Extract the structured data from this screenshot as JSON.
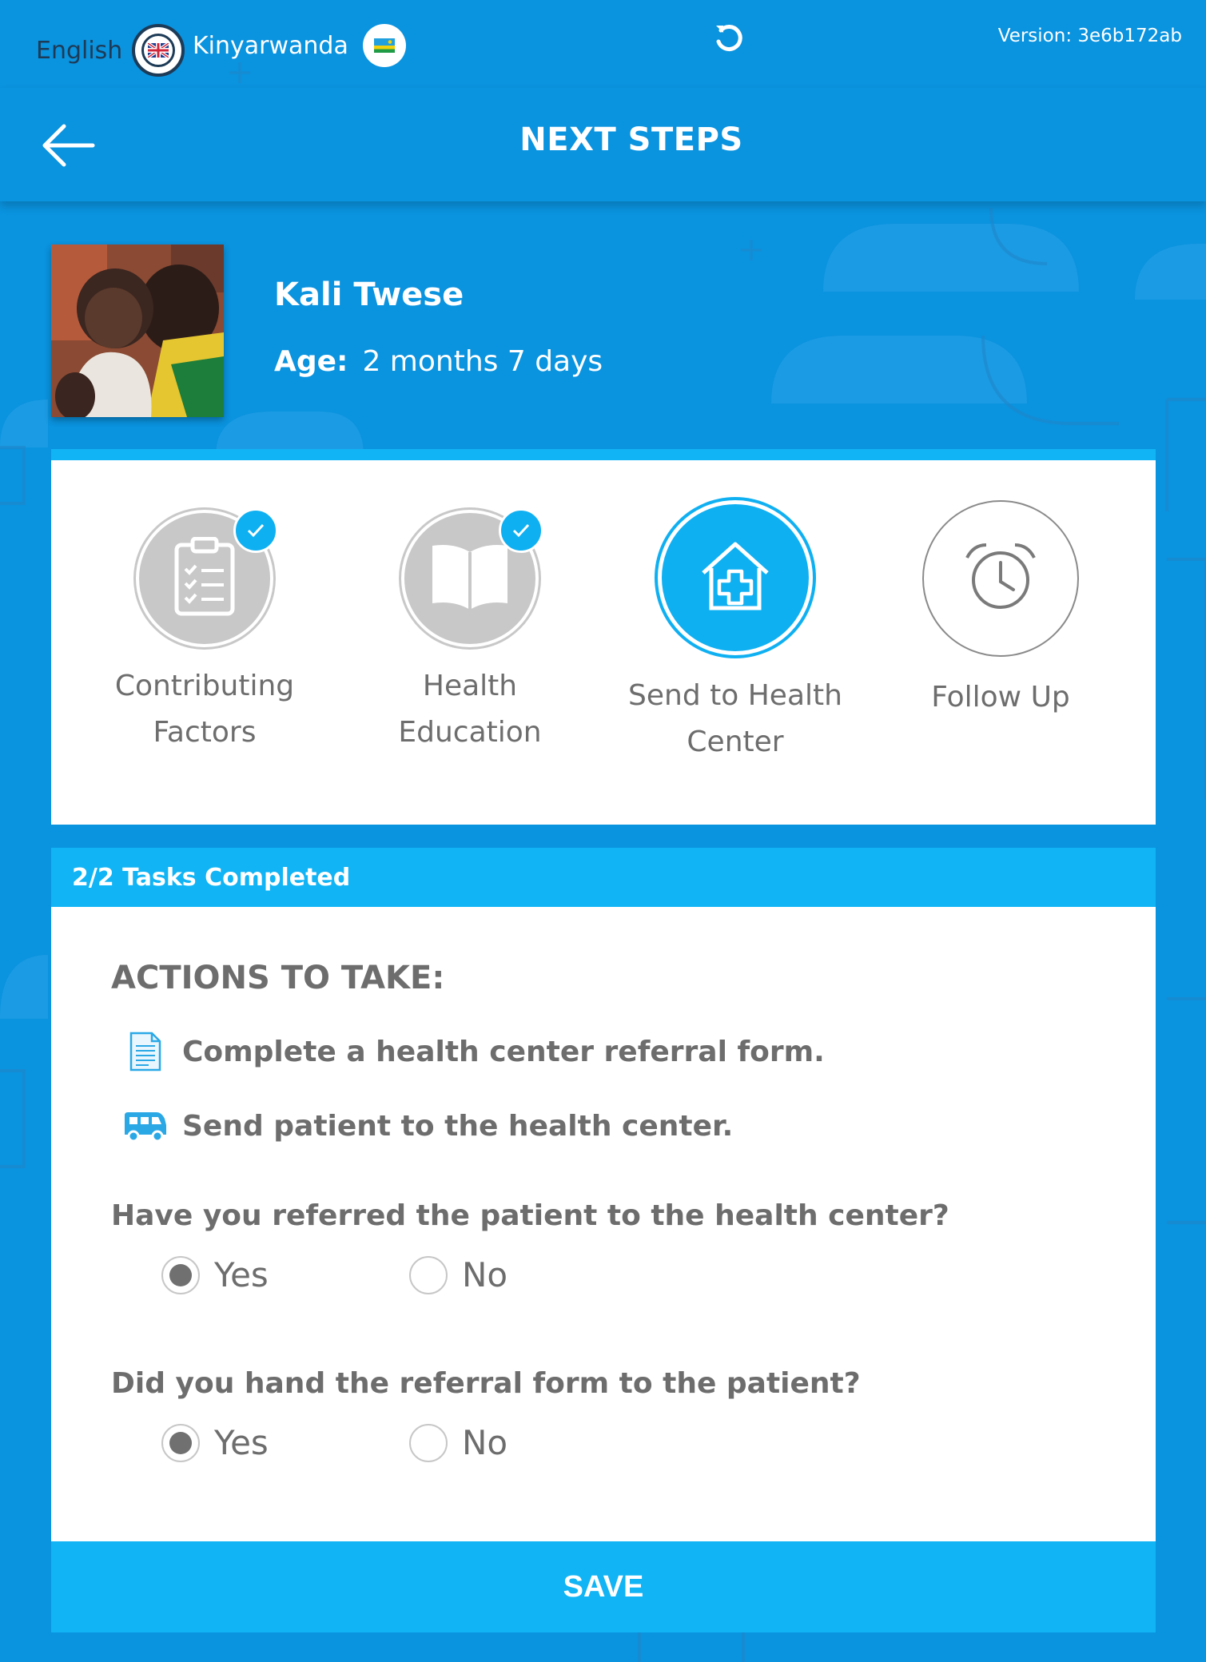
{
  "top_bar": {
    "languages": [
      {
        "label": "English",
        "flag": "uk-flag-icon",
        "selected": true
      },
      {
        "label": "Kinyarwanda",
        "flag": "rwanda-flag-icon",
        "selected": false
      }
    ],
    "refresh_icon": "refresh-icon",
    "version": "Version: 3e6b172ab"
  },
  "header": {
    "back_icon": "arrow-left-icon",
    "title": "NEXT STEPS"
  },
  "patient": {
    "name": "Kali Twese",
    "age_label": "Age:",
    "age_value": "2 months 7 days"
  },
  "steps": [
    {
      "line1": "Contributing",
      "line2": "Factors",
      "icon": "clipboard-checklist-icon",
      "state": "done"
    },
    {
      "line1": "Health",
      "line2": "Education",
      "icon": "open-book-icon",
      "state": "done"
    },
    {
      "line1": "Send to Health",
      "line2": "Center",
      "icon": "health-center-icon",
      "state": "active"
    },
    {
      "line1": "Follow Up",
      "line2": "",
      "icon": "alarm-clock-icon",
      "state": "pending"
    }
  ],
  "tasks": {
    "status": "2/2 Tasks Completed",
    "actions_title": "ACTIONS TO TAKE:",
    "actions": [
      {
        "text": "Complete a health center referral form.",
        "icon": "document-icon"
      },
      {
        "text": "Send patient to the health center.",
        "icon": "van-icon"
      }
    ],
    "questions": [
      {
        "text": "Have you referred the patient to the health center?",
        "options": [
          "Yes",
          "No"
        ],
        "selected": "Yes"
      },
      {
        "text": "Did you hand the referral form to the patient?",
        "options": [
          "Yes",
          "No"
        ],
        "selected": "Yes"
      }
    ],
    "save_label": "SAVE"
  },
  "colors": {
    "background": "#0a93df",
    "accent": "#11b4f5",
    "text_gray": "#6d6d6d",
    "done_gray": "#c8c8c8"
  }
}
